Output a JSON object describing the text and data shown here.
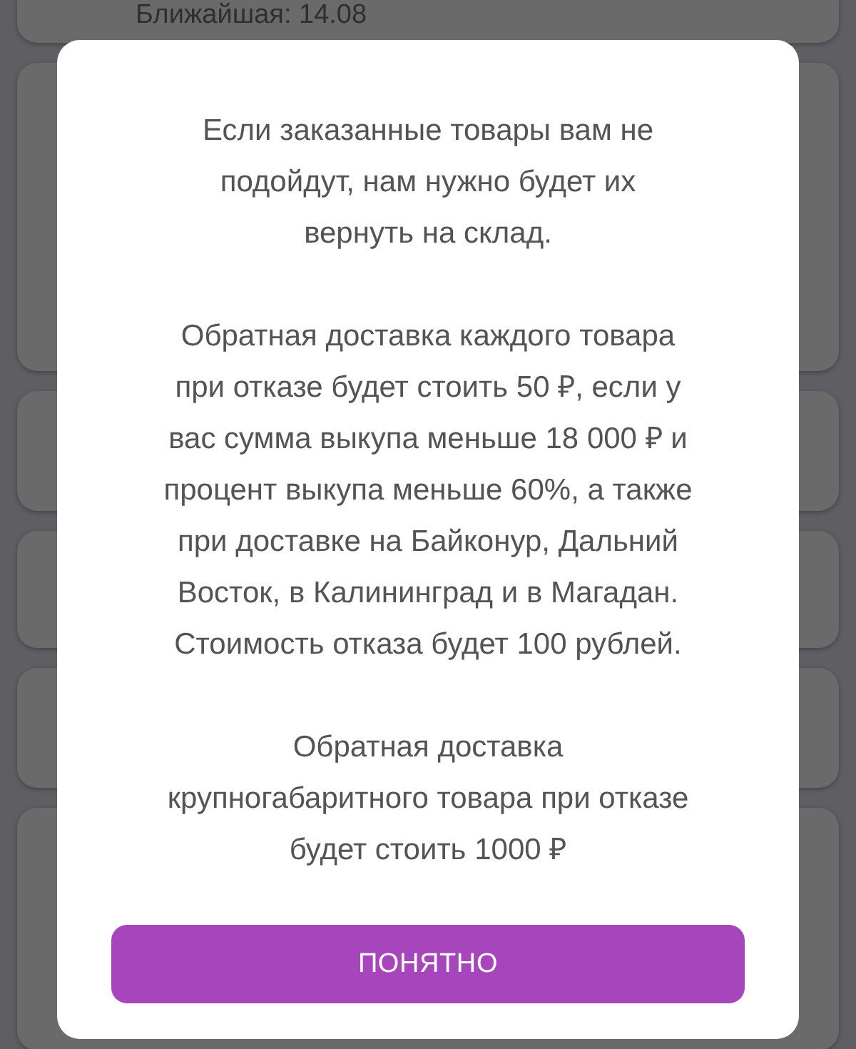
{
  "background": {
    "top_card": {
      "text": "Ближайшая: 14.08"
    }
  },
  "dialog": {
    "paragraphs": [
      {
        "lines": [
          "Если заказанные товары вам не",
          "подойдут, нам нужно будет их",
          "вернуть на склад."
        ]
      },
      {
        "lines": [
          "Обратная доставка каждого товара",
          "при отказе будет стоить 50 ₽, если у",
          "вас сумма выкупа меньше 18 000 ₽ и",
          "процент выкупа меньше 60%, а также",
          "при доставке на Байконур, Дальний",
          "Восток, в Калининград и в Магадан.",
          "Стоимость отказа будет 100 рублей."
        ]
      },
      {
        "lines": [
          "Обратная доставка",
          "крупногабаритного товара при отказе",
          "будет стоить 1000 ₽"
        ]
      }
    ],
    "button": {
      "label": "ПОНЯТНО"
    }
  }
}
